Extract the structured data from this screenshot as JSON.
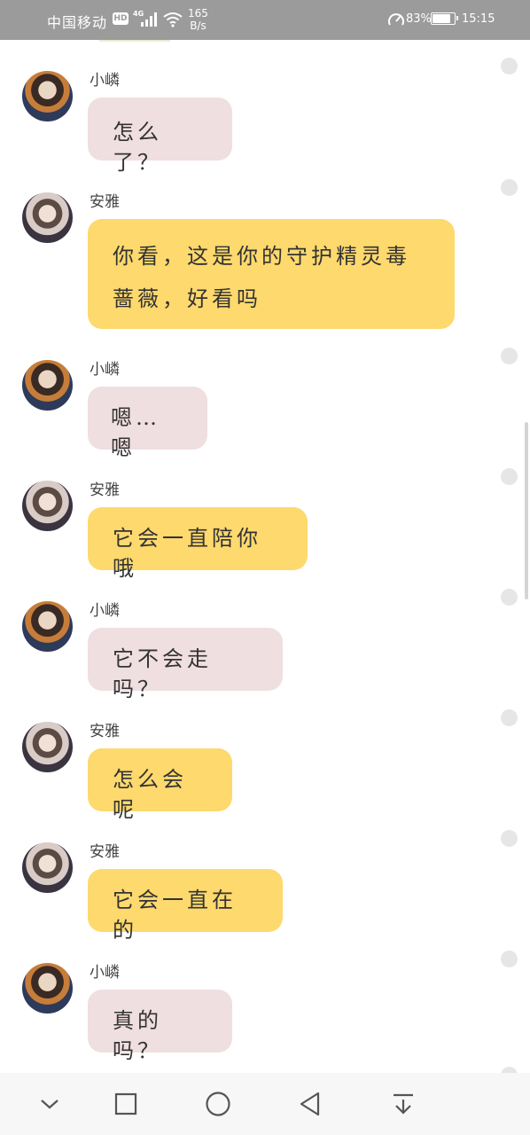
{
  "status_bar": {
    "carrier": "中国移动",
    "hd": "HD",
    "network": "4G",
    "speed_value": "165",
    "speed_unit": "B/s",
    "battery_percent": "83%",
    "battery_level": 0.83,
    "time": "15:15"
  },
  "messages": [
    {
      "sender": "小嶙",
      "text": "怎么了？",
      "avatar": "xiaolin-avatar",
      "bubble_color": "#f0dfe0"
    },
    {
      "sender": "安雅",
      "text": "你看，这是你的守护精灵毒蔷薇，好看吗",
      "avatar": "anya-avatar",
      "bubble_color": "#fdd96e"
    },
    {
      "sender": "小嶙",
      "text": "嗯…嗯",
      "avatar": "xiaolin-avatar",
      "bubble_color": "#f0dfe0"
    },
    {
      "sender": "安雅",
      "text": "它会一直陪你哦",
      "avatar": "anya-avatar",
      "bubble_color": "#fdd96e"
    },
    {
      "sender": "小嶙",
      "text": "它不会走吗？",
      "avatar": "xiaolin-avatar",
      "bubble_color": "#f0dfe0"
    },
    {
      "sender": "安雅",
      "text": "怎么会呢",
      "avatar": "anya-avatar",
      "bubble_color": "#fdd96e"
    },
    {
      "sender": "安雅",
      "text": "它会一直在的",
      "avatar": "anya-avatar",
      "bubble_color": "#fdd96e"
    },
    {
      "sender": "小嶙",
      "text": "真的吗？",
      "avatar": "xiaolin-avatar",
      "bubble_color": "#f0dfe0"
    }
  ],
  "nav_bar": {
    "icons": [
      "chevron-down-icon",
      "square-icon",
      "circle-home-icon",
      "triangle-back-icon",
      "download-icon"
    ]
  }
}
